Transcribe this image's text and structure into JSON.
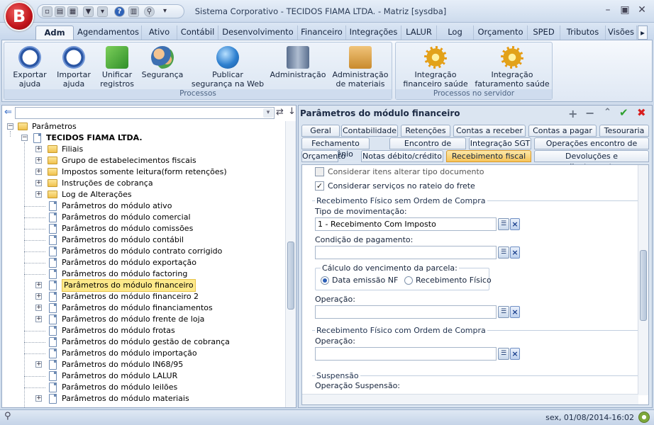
{
  "window": {
    "title": "Sistema Corporativo - TECIDOS FIAMA LTDA. - Matriz [sysdba]",
    "logo_letter": "B"
  },
  "ribbon": {
    "tabs": [
      "Adm",
      "Agendamentos",
      "Ativo",
      "Contábil",
      "Desenvolvimento",
      "Financeiro",
      "Integrações",
      "LALUR",
      "Log",
      "Orçamento",
      "SPED",
      "Tributos",
      "Visões"
    ],
    "groups": [
      {
        "label": "Processos",
        "buttons": [
          {
            "line1": "Exportar",
            "line2": "ajuda",
            "icon": "help-export-icon"
          },
          {
            "line1": "Importar",
            "line2": "ajuda",
            "icon": "help-import-icon"
          },
          {
            "line1": "Unificar",
            "line2": "registros",
            "icon": "merge-icon"
          },
          {
            "line1": "Segurança",
            "line2": "",
            "icon": "users-security-icon"
          },
          {
            "line1": "Publicar",
            "line2": "segurança na Web",
            "icon": "globe-publish-icon"
          },
          {
            "line1": "Administração",
            "line2": "",
            "icon": "server-admin-icon"
          },
          {
            "line1": "Administração",
            "line2": "de materiais",
            "icon": "materials-admin-icon"
          }
        ]
      },
      {
        "label": "Processos no servidor",
        "buttons": [
          {
            "line1": "Integração",
            "line2": "financeiro saúde",
            "icon": "gear-icon"
          },
          {
            "line1": "Integração",
            "line2": "faturamento saúde",
            "icon": "gear-icon"
          }
        ]
      }
    ]
  },
  "tree": {
    "root": "Parâmetros",
    "company": "TECIDOS FIAMA LTDA.",
    "folders": [
      "Filiais",
      "Grupo de estabelecimentos fiscais",
      "Impostos somente leitura(form retenções)",
      "Instruções de cobrança",
      "Log de Alterações"
    ],
    "items": [
      {
        "label": "Parâmetros do módulo ativo",
        "expandable": false
      },
      {
        "label": "Parâmetros do módulo comercial",
        "expandable": false
      },
      {
        "label": "Parâmetros do módulo comissões",
        "expandable": false
      },
      {
        "label": "Parâmetros do módulo contábil",
        "expandable": false
      },
      {
        "label": "Parâmetros do módulo contrato corrigido",
        "expandable": false
      },
      {
        "label": "Parâmetros do módulo exportação",
        "expandable": false
      },
      {
        "label": "Parâmetros do módulo factoring",
        "expandable": false
      },
      {
        "label": "Parâmetros do módulo financeiro",
        "expandable": true,
        "selected": true
      },
      {
        "label": "Parâmetros do módulo financeiro 2",
        "expandable": true
      },
      {
        "label": "Parâmetros do módulo financiamentos",
        "expandable": true
      },
      {
        "label": "Parâmetros do módulo frente de loja",
        "expandable": true
      },
      {
        "label": "Parâmetros do módulo frotas",
        "expandable": false
      },
      {
        "label": "Parâmetros do módulo gestão de cobrança",
        "expandable": false
      },
      {
        "label": "Parâmetros do módulo importação",
        "expandable": false
      },
      {
        "label": "Parâmetros do módulo IN68/95",
        "expandable": true
      },
      {
        "label": "Parâmetros do módulo LALUR",
        "expandable": false
      },
      {
        "label": "Parâmetros do módulo leilões",
        "expandable": false
      },
      {
        "label": "Parâmetros do módulo materiais",
        "expandable": true
      }
    ]
  },
  "panel": {
    "title": "Parâmetros do módulo financeiro",
    "tab_rows": [
      [
        "Geral",
        "Contabilidade",
        "Retenções",
        "Contas a receber",
        "Contas a pagar",
        "Tesouraria"
      ],
      [
        "Fechamento convênio",
        "Encontro de contas",
        "Integração SGT",
        "Operações encontro de contas"
      ],
      [
        "Orçamento",
        "Notas débito/crédito",
        "Recebimento fiscal",
        "Devoluções e adiantamentos"
      ]
    ],
    "active_tab": "Recebimento fiscal"
  },
  "form": {
    "chk_alterar": {
      "label": "Considerar itens alterar tipo documento",
      "checked": false
    },
    "chk_frete": {
      "label": "Considerar serviços no rateio do frete",
      "checked": true
    },
    "sem_ordem": {
      "title": "Recebimento Físico sem Ordem de Compra",
      "tipo_label": "Tipo de movimentação:",
      "tipo_value": "1 - Recebimento Com Imposto",
      "cond_label": "Condição de pagamento:",
      "cond_value": "",
      "calc_title": "Cálculo do vencimento da parcela:",
      "radio1": "Data emissão NF",
      "radio2": "Recebimento Físico",
      "operacao_label": "Operação:",
      "operacao_value": ""
    },
    "com_ordem": {
      "title": "Recebimento Físico com Ordem de Compra",
      "operacao_label": "Operação:",
      "operacao_value": ""
    },
    "suspensao": {
      "title": "Suspensão",
      "label": "Operação Suspensão:"
    }
  },
  "status": {
    "datetime": "sex, 01/08/2014-16:02"
  }
}
